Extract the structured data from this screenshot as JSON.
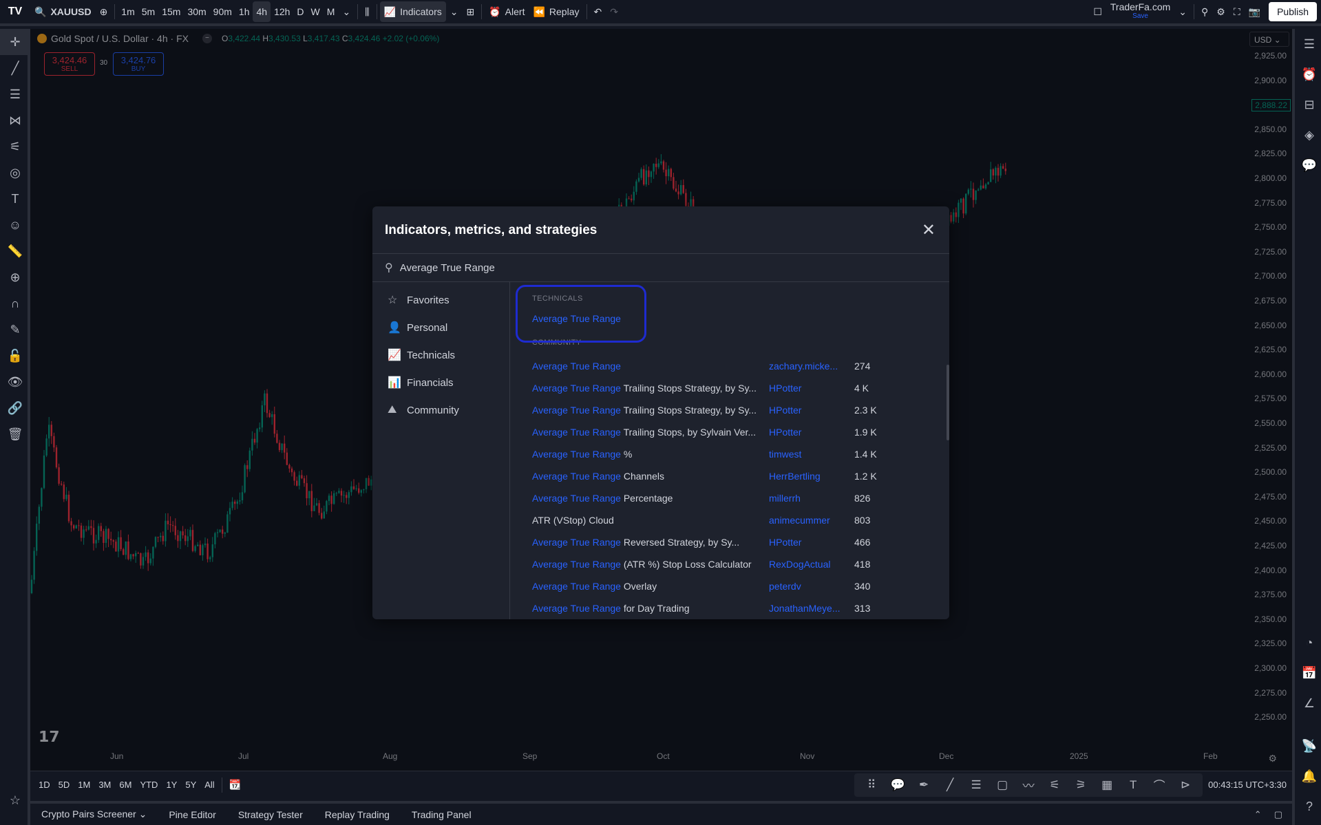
{
  "topbar": {
    "logo": "TV",
    "symbol": "XAUUSD",
    "intervals": [
      "1m",
      "5m",
      "15m",
      "30m",
      "90m",
      "1h",
      "4h",
      "12h",
      "D",
      "W",
      "M"
    ],
    "active_interval": "4h",
    "indicators_label": "Indicators",
    "alert_label": "Alert",
    "replay_label": "Replay",
    "account_name": "TraderFa.com",
    "account_status": "Save",
    "publish_label": "Publish"
  },
  "legend": {
    "title": "Gold Spot / U.S. Dollar · 4h · FX",
    "o_label": "O",
    "o": "3,422.44",
    "h_label": "H",
    "h": "3,430.53",
    "l_label": "L",
    "l": "3,417.43",
    "c_label": "C",
    "c": "3,424.46",
    "change": "+2.02 (+0.06%)",
    "sell_price": "3,424.46",
    "sell_label": "SELL",
    "spread": "30",
    "buy_price": "3,424.76",
    "buy_label": "BUY",
    "currency": "USD"
  },
  "price_axis": [
    "2,925.00",
    "2,900.00",
    "2,875.00",
    "2,850.00",
    "2,825.00",
    "2,800.00",
    "2,775.00",
    "2,750.00",
    "2,725.00",
    "2,700.00",
    "2,675.00",
    "2,650.00",
    "2,625.00",
    "2,600.00",
    "2,575.00",
    "2,550.00",
    "2,525.00",
    "2,500.00",
    "2,475.00",
    "2,450.00",
    "2,425.00",
    "2,400.00",
    "2,375.00",
    "2,350.00",
    "2,325.00",
    "2,300.00",
    "2,275.00",
    "2,250.00"
  ],
  "last_price_tag": "2,888.22",
  "time_axis": [
    "Jun",
    "Jul",
    "Aug",
    "Sep",
    "Oct",
    "Nov",
    "Dec",
    "2025",
    "Feb"
  ],
  "bottombar": {
    "ranges": [
      "1D",
      "5D",
      "1M",
      "3M",
      "6M",
      "YTD",
      "1Y",
      "5Y",
      "All"
    ],
    "clock": "00:43:15 UTC+3:30"
  },
  "panels": [
    "Crypto Pairs Screener",
    "Pine Editor",
    "Strategy Tester",
    "Replay Trading",
    "Trading Panel"
  ],
  "modal": {
    "title": "Indicators, metrics, and strategies",
    "search_value": "Average True Range",
    "sidebar": [
      {
        "label": "Favorites",
        "icon": "star-icon",
        "glyph": "☆"
      },
      {
        "label": "Personal",
        "icon": "person-icon",
        "glyph": "👤"
      },
      {
        "label": "Technicals",
        "icon": "chart-icon",
        "glyph": "📈"
      },
      {
        "label": "Financials",
        "icon": "bars-icon",
        "glyph": "📊"
      },
      {
        "label": "Community",
        "icon": "mountain-icon",
        "glyph": "⛰"
      }
    ],
    "technicals_header": "TECHNICALS",
    "technicals_result": "Average True Range",
    "community_header": "COMMUNITY",
    "community": [
      {
        "hl": "Average True Range",
        "rest": "",
        "author": "zachary.micke...",
        "count": "274"
      },
      {
        "hl": "Average True Range",
        "rest": " Trailing Stops Strategy, by Sy...",
        "author": "HPotter",
        "count": "4 K"
      },
      {
        "hl": "Average True Range",
        "rest": " Trailing Stops Strategy, by Sy...",
        "author": "HPotter",
        "count": "2.3 K"
      },
      {
        "hl": "Average True Range",
        "rest": " Trailing Stops, by Sylvain Ver...",
        "author": "HPotter",
        "count": "1.9 K"
      },
      {
        "hl": "Average True Range",
        "rest": " %",
        "author": "timwest",
        "count": "1.4 K"
      },
      {
        "hl": "Average True Range",
        "rest": " Channels",
        "author": "HerrBertling",
        "count": "1.2 K"
      },
      {
        "hl": "Average True Range",
        "rest": " Percentage",
        "author": "millerrh",
        "count": "826"
      },
      {
        "hl": "",
        "rest": "ATR (VStop) Cloud",
        "author": "animecummer",
        "count": "803"
      },
      {
        "hl": "Average True Range",
        "rest": " Reversed Strategy, by Sy...",
        "author": "HPotter",
        "count": "466"
      },
      {
        "hl": "Average True Range",
        "rest": " (ATR %) Stop Loss Calculator",
        "author": "RexDogActual",
        "count": "418"
      },
      {
        "hl": "Average True Range",
        "rest": " Overlay",
        "author": "peterdv",
        "count": "340"
      },
      {
        "hl": "Average True Range",
        "rest": " for Day Trading",
        "author": "JonathanMeye...",
        "count": "313"
      }
    ]
  },
  "colors": {
    "up": "#089981",
    "down": "#f23645",
    "accent": "#2962ff",
    "highlight_box": "#1e2bd0"
  }
}
